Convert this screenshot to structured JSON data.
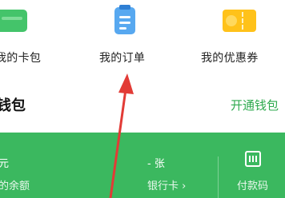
{
  "quick_entries": [
    {
      "label": "我的卡包",
      "icon": "card-wallet-icon",
      "color": "#44c46a"
    },
    {
      "label": "我的订单",
      "icon": "order-note-icon",
      "color": "#57a8f0"
    },
    {
      "label": "我的优惠券",
      "icon": "coupon-ticket-icon",
      "color": "#ffc21a"
    }
  ],
  "wallet": {
    "title": "钱包",
    "open_link": "开通钱包",
    "panel_color": "#3bb85f",
    "balance": {
      "unit": "元",
      "label": "的余额"
    },
    "bank_cards": {
      "count": "- 张",
      "label": "银行卡 ›"
    },
    "pay_code": {
      "label": "付款码",
      "icon": "pay-code-icon"
    }
  },
  "annotation": {
    "color": "#e23b36",
    "icon": "red-arrow-icon"
  }
}
